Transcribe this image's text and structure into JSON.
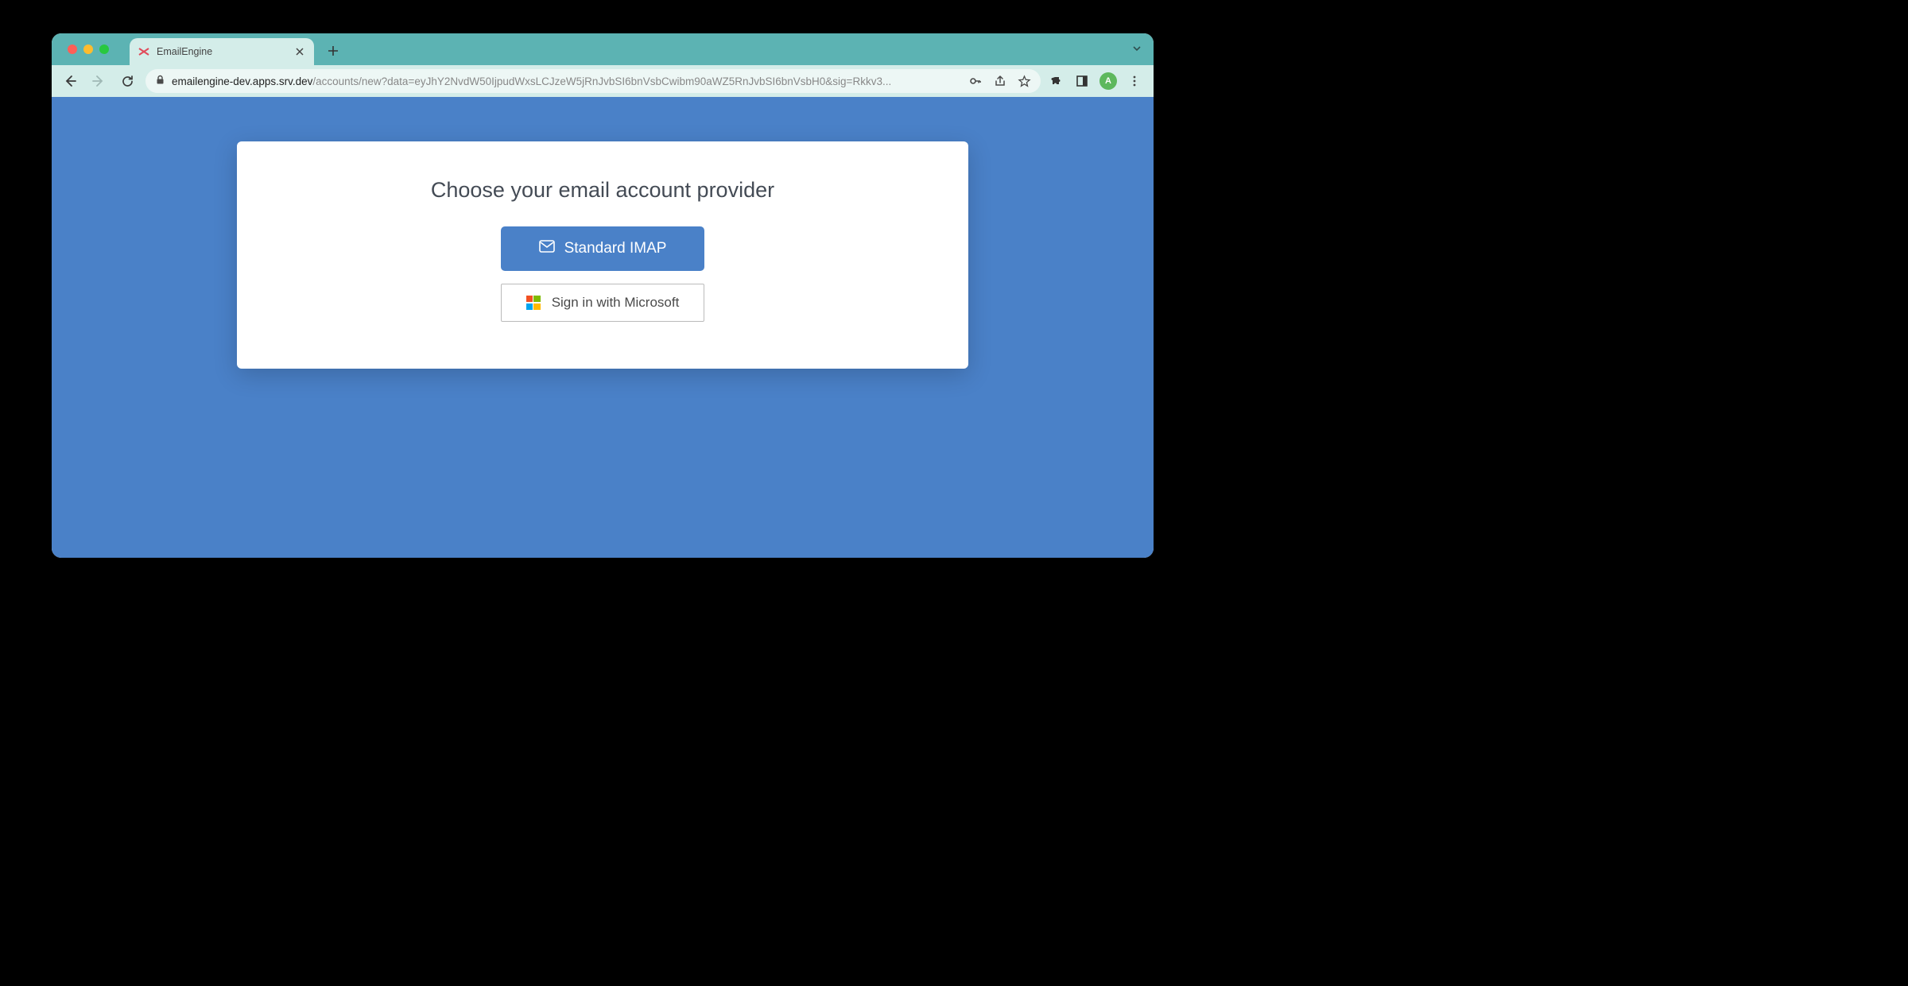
{
  "browser": {
    "tab": {
      "title": "EmailEngine"
    },
    "address": {
      "host": "emailengine-dev.apps.srv.dev",
      "path": "/accounts/new?data=eyJhY2NvdW50IjpudWxsLCJzeW5jRnJvbSI6bnVsbCwibm90aWZ5RnJvbSI6bnVsbH0&sig=Rkkv3..."
    },
    "avatar_letter": "A"
  },
  "page": {
    "heading": "Choose your email account provider",
    "buttons": {
      "imap_label": "Standard IMAP",
      "microsoft_label": "Sign in with Microsoft"
    }
  }
}
